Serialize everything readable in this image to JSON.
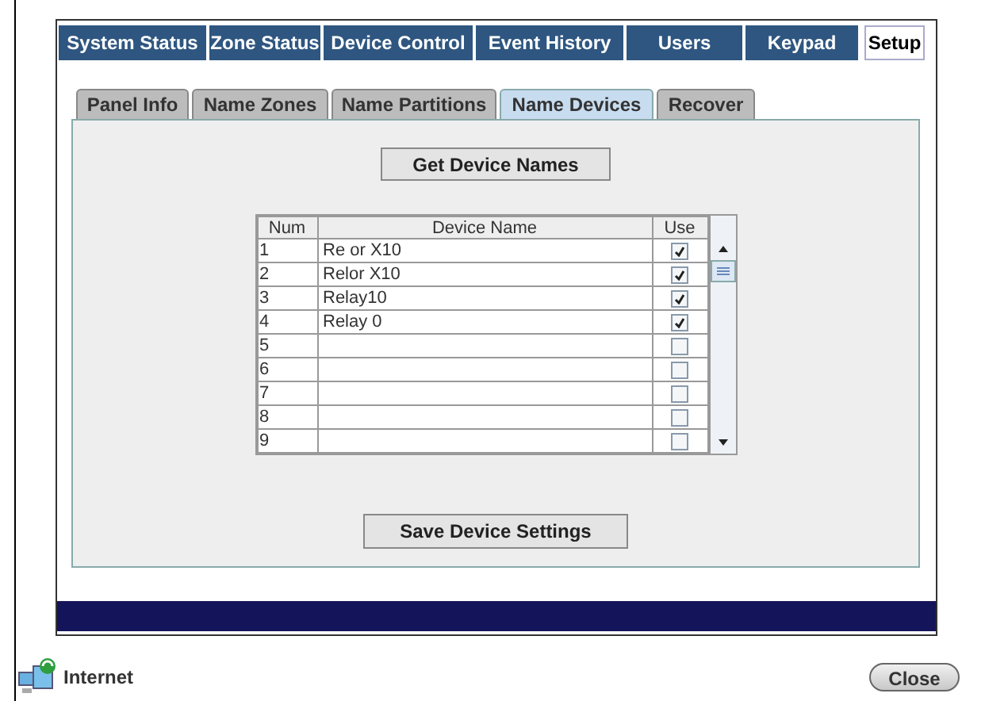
{
  "main_tabs": [
    {
      "label": "System Status",
      "selected": false
    },
    {
      "label": "Zone Status",
      "selected": false
    },
    {
      "label": "Device Control",
      "selected": false
    },
    {
      "label": "Event History",
      "selected": false
    },
    {
      "label": "Users",
      "selected": false
    },
    {
      "label": "Keypad",
      "selected": false
    },
    {
      "label": "Setup",
      "selected": true
    }
  ],
  "sub_tabs": [
    {
      "label": "Panel Info",
      "selected": false
    },
    {
      "label": "Name Zones",
      "selected": false
    },
    {
      "label": "Name Partitions",
      "selected": false
    },
    {
      "label": "Name Devices",
      "selected": true
    },
    {
      "label": "Recover",
      "selected": false
    }
  ],
  "get_button": "Get Device Names",
  "table": {
    "columns": [
      "Num",
      "Device Name",
      "Use"
    ],
    "rows": [
      {
        "num": "1",
        "name": "Re or X10",
        "use": true
      },
      {
        "num": "2",
        "name": "Relor X10",
        "use": true
      },
      {
        "num": "3",
        "name": "Relay10",
        "use": true
      },
      {
        "num": "4",
        "name": "Relay 0",
        "use": true
      },
      {
        "num": "5",
        "use": false
      },
      {
        "num": "6",
        "use": false
      },
      {
        "num": "7",
        "use": false
      },
      {
        "num": "8",
        "use": false
      },
      {
        "num": "9",
        "use": false
      }
    ]
  },
  "save_button": "Save Device Settings",
  "status": "Internet",
  "close_button": "Close"
}
